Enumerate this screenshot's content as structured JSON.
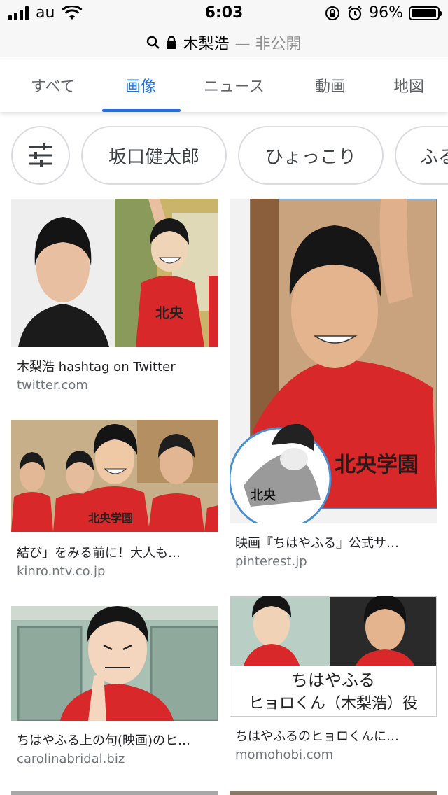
{
  "status": {
    "carrier": "au",
    "time": "6:03",
    "battery": "96%",
    "battery_level": 0.96
  },
  "urlbar": {
    "query": "木梨浩",
    "suffix": "— 非公開"
  },
  "tabs": [
    "すべて",
    "画像",
    "ニュース",
    "動画",
    "地図"
  ],
  "active_tab": "画像",
  "chips": [
    "坂口健太郎",
    "ひょっこり",
    "ふる"
  ],
  "results": [
    {
      "title": "木梨浩 hashtag on Twitter",
      "domain": "twitter.com"
    },
    {
      "title": "映画『ちはやふる』公式サ…",
      "domain": "pinterest.jp"
    },
    {
      "title": "結び」をみる前に！大人も…",
      "domain": "kinro.ntv.co.jp"
    },
    {
      "title": "ちはやふる上の句(映画)のヒ…",
      "domain": "carolinabridal.biz"
    },
    {
      "title": "ちはやふるのヒョロくんに…",
      "domain": "momohobi.com"
    }
  ],
  "image_text": {
    "shirt": "北央",
    "shirt2": "北央学園",
    "caption_line1": "ちはやふる",
    "caption_line2": "ヒョロくん（木梨浩）役"
  },
  "colors": {
    "accent": "#1a73e8",
    "shirt_red": "#d8282a"
  }
}
